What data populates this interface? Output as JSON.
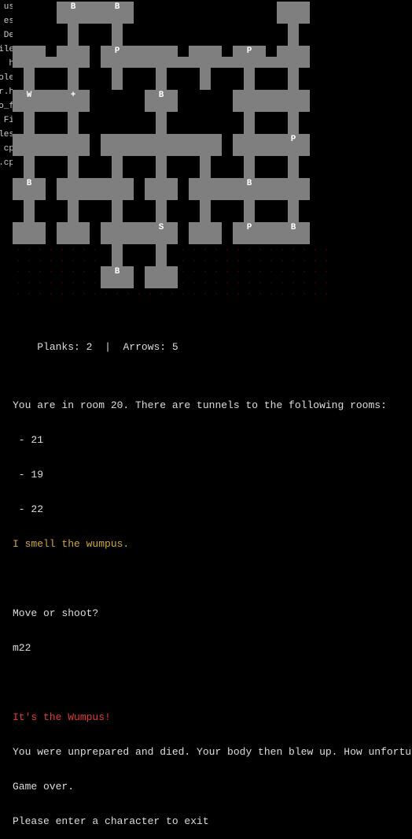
{
  "sidebar": {
    "fragments": [
      "us",
      "es",
      "De",
      "ile",
      "h",
      "ole",
      "r.h",
      "o_f",
      "Fi",
      "les",
      "cp",
      ".cp"
    ]
  },
  "game": {
    "cols": 29,
    "rows": 27,
    "legend": {
      "empty": "bg",
      "dot": "dot",
      "room": "room",
      "corridor": "corr"
    },
    "map": [
      [
        0,
        0,
        0,
        0,
        3,
        4,
        3,
        3,
        3,
        4,
        3,
        0,
        0,
        0,
        0,
        0,
        0,
        0,
        0,
        0,
        0,
        0,
        0,
        0,
        3,
        3,
        3,
        0,
        0
      ],
      [
        0,
        0,
        0,
        0,
        3,
        3,
        3,
        3,
        3,
        3,
        3,
        0,
        0,
        0,
        0,
        0,
        0,
        0,
        0,
        0,
        0,
        0,
        0,
        0,
        3,
        3,
        3,
        0,
        0
      ],
      [
        0,
        0,
        0,
        0,
        0,
        3,
        0,
        0,
        0,
        3,
        0,
        0,
        0,
        0,
        0,
        0,
        0,
        0,
        0,
        0,
        0,
        0,
        0,
        0,
        0,
        3,
        0,
        0,
        0
      ],
      [
        0,
        0,
        0,
        0,
        0,
        3,
        0,
        0,
        0,
        3,
        0,
        0,
        0,
        0,
        0,
        0,
        0,
        0,
        0,
        0,
        0,
        0,
        0,
        0,
        0,
        3,
        0,
        0,
        0
      ],
      [
        3,
        3,
        3,
        0,
        3,
        3,
        3,
        0,
        3,
        4,
        3,
        3,
        3,
        3,
        3,
        0,
        3,
        3,
        3,
        0,
        3,
        4,
        3,
        0,
        3,
        3,
        3,
        0,
        0
      ],
      [
        3,
        3,
        3,
        3,
        3,
        3,
        3,
        0,
        3,
        3,
        3,
        3,
        3,
        3,
        3,
        3,
        3,
        3,
        3,
        3,
        3,
        3,
        3,
        3,
        3,
        3,
        3,
        0,
        0
      ],
      [
        0,
        3,
        0,
        0,
        0,
        3,
        0,
        0,
        0,
        3,
        0,
        0,
        0,
        3,
        0,
        0,
        0,
        3,
        0,
        0,
        0,
        3,
        0,
        0,
        0,
        3,
        0,
        0,
        0
      ],
      [
        0,
        3,
        0,
        0,
        0,
        3,
        0,
        0,
        0,
        3,
        0,
        0,
        0,
        3,
        0,
        0,
        0,
        3,
        0,
        0,
        0,
        3,
        0,
        0,
        0,
        3,
        0,
        0,
        0
      ],
      [
        3,
        4,
        3,
        3,
        3,
        4,
        3,
        0,
        0,
        0,
        0,
        0,
        3,
        4,
        3,
        0,
        0,
        0,
        0,
        0,
        3,
        3,
        3,
        3,
        3,
        3,
        3,
        0,
        0
      ],
      [
        3,
        3,
        3,
        3,
        3,
        3,
        3,
        0,
        0,
        0,
        0,
        0,
        3,
        3,
        3,
        0,
        0,
        0,
        0,
        0,
        3,
        3,
        3,
        3,
        3,
        3,
        3,
        0,
        0
      ],
      [
        0,
        3,
        0,
        0,
        0,
        3,
        0,
        0,
        0,
        0,
        0,
        0,
        0,
        3,
        0,
        0,
        0,
        0,
        0,
        0,
        0,
        3,
        0,
        0,
        0,
        3,
        0,
        0,
        0
      ],
      [
        0,
        3,
        0,
        0,
        0,
        3,
        0,
        0,
        0,
        0,
        0,
        0,
        0,
        3,
        0,
        0,
        0,
        0,
        0,
        0,
        0,
        3,
        0,
        0,
        0,
        3,
        0,
        0,
        0
      ],
      [
        3,
        3,
        3,
        3,
        3,
        3,
        3,
        0,
        3,
        3,
        3,
        3,
        3,
        3,
        3,
        3,
        3,
        3,
        3,
        0,
        3,
        3,
        3,
        3,
        3,
        4,
        3,
        0,
        0
      ],
      [
        3,
        3,
        3,
        3,
        3,
        3,
        3,
        0,
        3,
        3,
        3,
        3,
        3,
        3,
        3,
        3,
        3,
        3,
        3,
        0,
        3,
        3,
        3,
        3,
        3,
        3,
        3,
        0,
        0
      ],
      [
        0,
        3,
        0,
        0,
        0,
        3,
        0,
        0,
        0,
        3,
        0,
        0,
        0,
        3,
        0,
        0,
        0,
        3,
        0,
        0,
        0,
        3,
        0,
        0,
        0,
        3,
        0,
        0,
        0
      ],
      [
        0,
        3,
        0,
        0,
        0,
        3,
        0,
        0,
        0,
        3,
        0,
        0,
        0,
        3,
        0,
        0,
        0,
        3,
        0,
        0,
        0,
        3,
        0,
        0,
        0,
        3,
        0,
        0,
        0
      ],
      [
        3,
        4,
        3,
        0,
        3,
        3,
        3,
        3,
        3,
        3,
        3,
        0,
        3,
        3,
        3,
        0,
        3,
        3,
        3,
        3,
        3,
        4,
        3,
        3,
        3,
        3,
        3,
        0,
        0
      ],
      [
        3,
        3,
        3,
        0,
        3,
        3,
        3,
        3,
        3,
        3,
        3,
        0,
        3,
        3,
        3,
        0,
        3,
        3,
        3,
        3,
        3,
        3,
        3,
        3,
        3,
        3,
        3,
        0,
        0
      ],
      [
        0,
        3,
        0,
        0,
        0,
        3,
        0,
        0,
        0,
        3,
        0,
        0,
        0,
        3,
        0,
        0,
        0,
        3,
        0,
        0,
        0,
        3,
        0,
        0,
        0,
        3,
        0,
        0,
        0
      ],
      [
        0,
        3,
        0,
        0,
        0,
        3,
        0,
        0,
        0,
        3,
        0,
        0,
        0,
        3,
        0,
        0,
        0,
        3,
        0,
        0,
        0,
        3,
        0,
        0,
        0,
        3,
        0,
        0,
        0
      ],
      [
        3,
        3,
        3,
        0,
        3,
        3,
        3,
        0,
        3,
        3,
        3,
        3,
        3,
        4,
        3,
        0,
        3,
        3,
        3,
        0,
        3,
        4,
        3,
        3,
        3,
        4,
        3,
        0,
        0
      ],
      [
        3,
        3,
        3,
        0,
        3,
        3,
        3,
        0,
        3,
        3,
        3,
        3,
        3,
        3,
        3,
        0,
        3,
        3,
        3,
        0,
        3,
        3,
        3,
        3,
        3,
        3,
        3,
        0,
        0
      ],
      [
        1,
        1,
        1,
        1,
        1,
        1,
        1,
        1,
        0,
        3,
        0,
        0,
        0,
        3,
        0,
        1,
        1,
        1,
        1,
        1,
        1,
        1,
        1,
        1,
        1,
        1,
        1,
        1,
        1
      ],
      [
        1,
        1,
        1,
        1,
        1,
        1,
        1,
        1,
        0,
        3,
        0,
        0,
        0,
        3,
        0,
        1,
        1,
        1,
        1,
        1,
        1,
        1,
        1,
        1,
        1,
        1,
        1,
        1,
        1
      ],
      [
        1,
        1,
        1,
        1,
        1,
        1,
        1,
        1,
        3,
        4,
        3,
        0,
        3,
        3,
        3,
        1,
        1,
        1,
        1,
        1,
        1,
        1,
        1,
        1,
        1,
        1,
        1,
        1,
        1
      ],
      [
        1,
        1,
        1,
        1,
        1,
        1,
        1,
        1,
        3,
        3,
        3,
        0,
        3,
        3,
        3,
        1,
        1,
        1,
        1,
        1,
        1,
        1,
        1,
        1,
        1,
        1,
        1,
        1,
        1
      ],
      [
        1,
        1,
        1,
        1,
        1,
        1,
        1,
        1,
        1,
        1,
        1,
        1,
        1,
        1,
        1,
        1,
        1,
        1,
        1,
        1,
        1,
        1,
        1,
        1,
        1,
        1,
        1,
        1,
        1
      ]
    ],
    "labels": {
      "5,0": "B",
      "9,0": "B",
      "9,4": "P",
      "21,4": "P",
      "1,8": "W",
      "5,8": "+",
      "13,8": "B",
      "25,12": "P",
      "1,16": "B",
      "21,16": "B",
      "13,20": "S",
      "21,20": "P",
      "25,20": "B",
      "9,24": "B"
    }
  },
  "status": {
    "planks": "2",
    "arrows": "5",
    "divider": "|"
  },
  "msgs": {
    "room_line": "You are in room 20. There are tunnels to the following rooms:",
    "tunnels": [
      " - 21",
      " - 19",
      " - 22"
    ],
    "smell": "I smell the wumpus.",
    "prompt": "Move or shoot?",
    "input": "m22",
    "wump": "It's the Wumpus!",
    "death": "You were unprepared and died. Your body then blew up. How unfortunate.",
    "over": "Game over.",
    "exit": "Please enter a character to exit"
  },
  "lbl": {
    "planks": "Planks:",
    "arrows": "Arrows:"
  }
}
